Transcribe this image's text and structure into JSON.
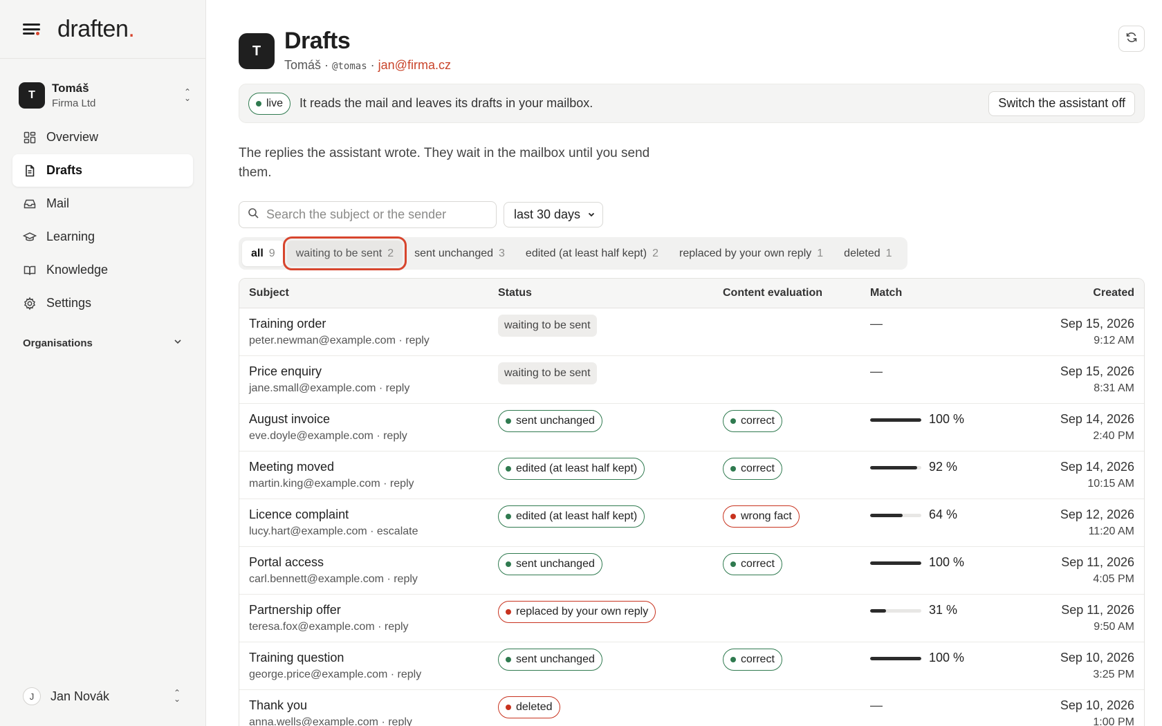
{
  "brand": {
    "logo_text": "draften",
    "logo_dot": "."
  },
  "account": {
    "initial": "T",
    "name": "Tomáš",
    "org": "Firma Ltd"
  },
  "nav": [
    {
      "label": "Overview",
      "icon": "grid-icon",
      "active": false
    },
    {
      "label": "Drafts",
      "icon": "document-icon",
      "active": true
    },
    {
      "label": "Mail",
      "icon": "inbox-icon",
      "active": false
    },
    {
      "label": "Learning",
      "icon": "graduation-cap-icon",
      "active": false
    },
    {
      "label": "Knowledge",
      "icon": "book-icon",
      "active": false
    },
    {
      "label": "Settings",
      "icon": "gear-icon",
      "active": false
    }
  ],
  "organisations_label": "Organisations",
  "user": {
    "initial": "J",
    "name": "Jan Novák"
  },
  "header": {
    "initial": "T",
    "title": "Drafts",
    "name": "Tomáš",
    "handle": "@tomas",
    "email": "jan@firma.cz",
    "separator": "·"
  },
  "banner": {
    "live_label": "live",
    "text": "It reads the mail and leaves its drafts in your mailbox.",
    "switch_label": "Switch the assistant off"
  },
  "description": "The replies the assistant wrote. They wait in the mailbox until you send them.",
  "search": {
    "placeholder": "Search the subject or the sender",
    "value": ""
  },
  "period_select": {
    "value": "last 30 days"
  },
  "tabs": [
    {
      "label": "all",
      "count": "9"
    },
    {
      "label": "waiting to be sent",
      "count": "2"
    },
    {
      "label": "sent unchanged",
      "count": "3"
    },
    {
      "label": "edited (at least half kept)",
      "count": "2"
    },
    {
      "label": "replaced by your own reply",
      "count": "1"
    },
    {
      "label": "deleted",
      "count": "1"
    }
  ],
  "table": {
    "headers": {
      "subject": "Subject",
      "status": "Status",
      "evaluation": "Content evaluation",
      "match": "Match",
      "created": "Created"
    },
    "rows": [
      {
        "subject": "Training order",
        "sender": "peter.newman@example.com · reply",
        "status": "waiting to be sent",
        "status_kind": "grey",
        "evaluation": "",
        "evaluation_kind": "",
        "match": null,
        "match_text": "—",
        "date": "Sep 15, 2026",
        "time": "9:12 AM"
      },
      {
        "subject": "Price enquiry",
        "sender": "jane.small@example.com · reply",
        "status": "waiting to be sent",
        "status_kind": "grey",
        "evaluation": "",
        "evaluation_kind": "",
        "match": null,
        "match_text": "—",
        "date": "Sep 15, 2026",
        "time": "8:31 AM"
      },
      {
        "subject": "August invoice",
        "sender": "eve.doyle@example.com · reply",
        "status": "sent unchanged",
        "status_kind": "green",
        "evaluation": "correct",
        "evaluation_kind": "green",
        "match": 100,
        "match_text": "100 %",
        "date": "Sep 14, 2026",
        "time": "2:40 PM"
      },
      {
        "subject": "Meeting moved",
        "sender": "martin.king@example.com · reply",
        "status": "edited (at least half kept)",
        "status_kind": "green",
        "evaluation": "correct",
        "evaluation_kind": "green",
        "match": 92,
        "match_text": "92 %",
        "date": "Sep 14, 2026",
        "time": "10:15 AM"
      },
      {
        "subject": "Licence complaint",
        "sender": "lucy.hart@example.com · escalate",
        "status": "edited (at least half kept)",
        "status_kind": "green",
        "evaluation": "wrong fact",
        "evaluation_kind": "red",
        "match": 64,
        "match_text": "64 %",
        "date": "Sep 12, 2026",
        "time": "11:20 AM"
      },
      {
        "subject": "Portal access",
        "sender": "carl.bennett@example.com · reply",
        "status": "sent unchanged",
        "status_kind": "green",
        "evaluation": "correct",
        "evaluation_kind": "green",
        "match": 100,
        "match_text": "100 %",
        "date": "Sep 11, 2026",
        "time": "4:05 PM"
      },
      {
        "subject": "Partnership offer",
        "sender": "teresa.fox@example.com · reply",
        "status": "replaced by your own reply",
        "status_kind": "red",
        "evaluation": "",
        "evaluation_kind": "",
        "match": 31,
        "match_text": "31 %",
        "date": "Sep 11, 2026",
        "time": "9:50 AM"
      },
      {
        "subject": "Training question",
        "sender": "george.price@example.com · reply",
        "status": "sent unchanged",
        "status_kind": "green",
        "evaluation": "correct",
        "evaluation_kind": "green",
        "match": 100,
        "match_text": "100 %",
        "date": "Sep 10, 2026",
        "time": "3:25 PM"
      },
      {
        "subject": "Thank you",
        "sender": "anna.wells@example.com · reply",
        "status": "deleted",
        "status_kind": "red",
        "evaluation": "",
        "evaluation_kind": "",
        "match": null,
        "match_text": "—",
        "date": "Sep 10, 2026",
        "time": "1:00 PM"
      }
    ]
  },
  "colors": {
    "accent": "#d7452d",
    "green": "#2f7a4f",
    "red": "#c8321e",
    "email": "#c9442a"
  }
}
